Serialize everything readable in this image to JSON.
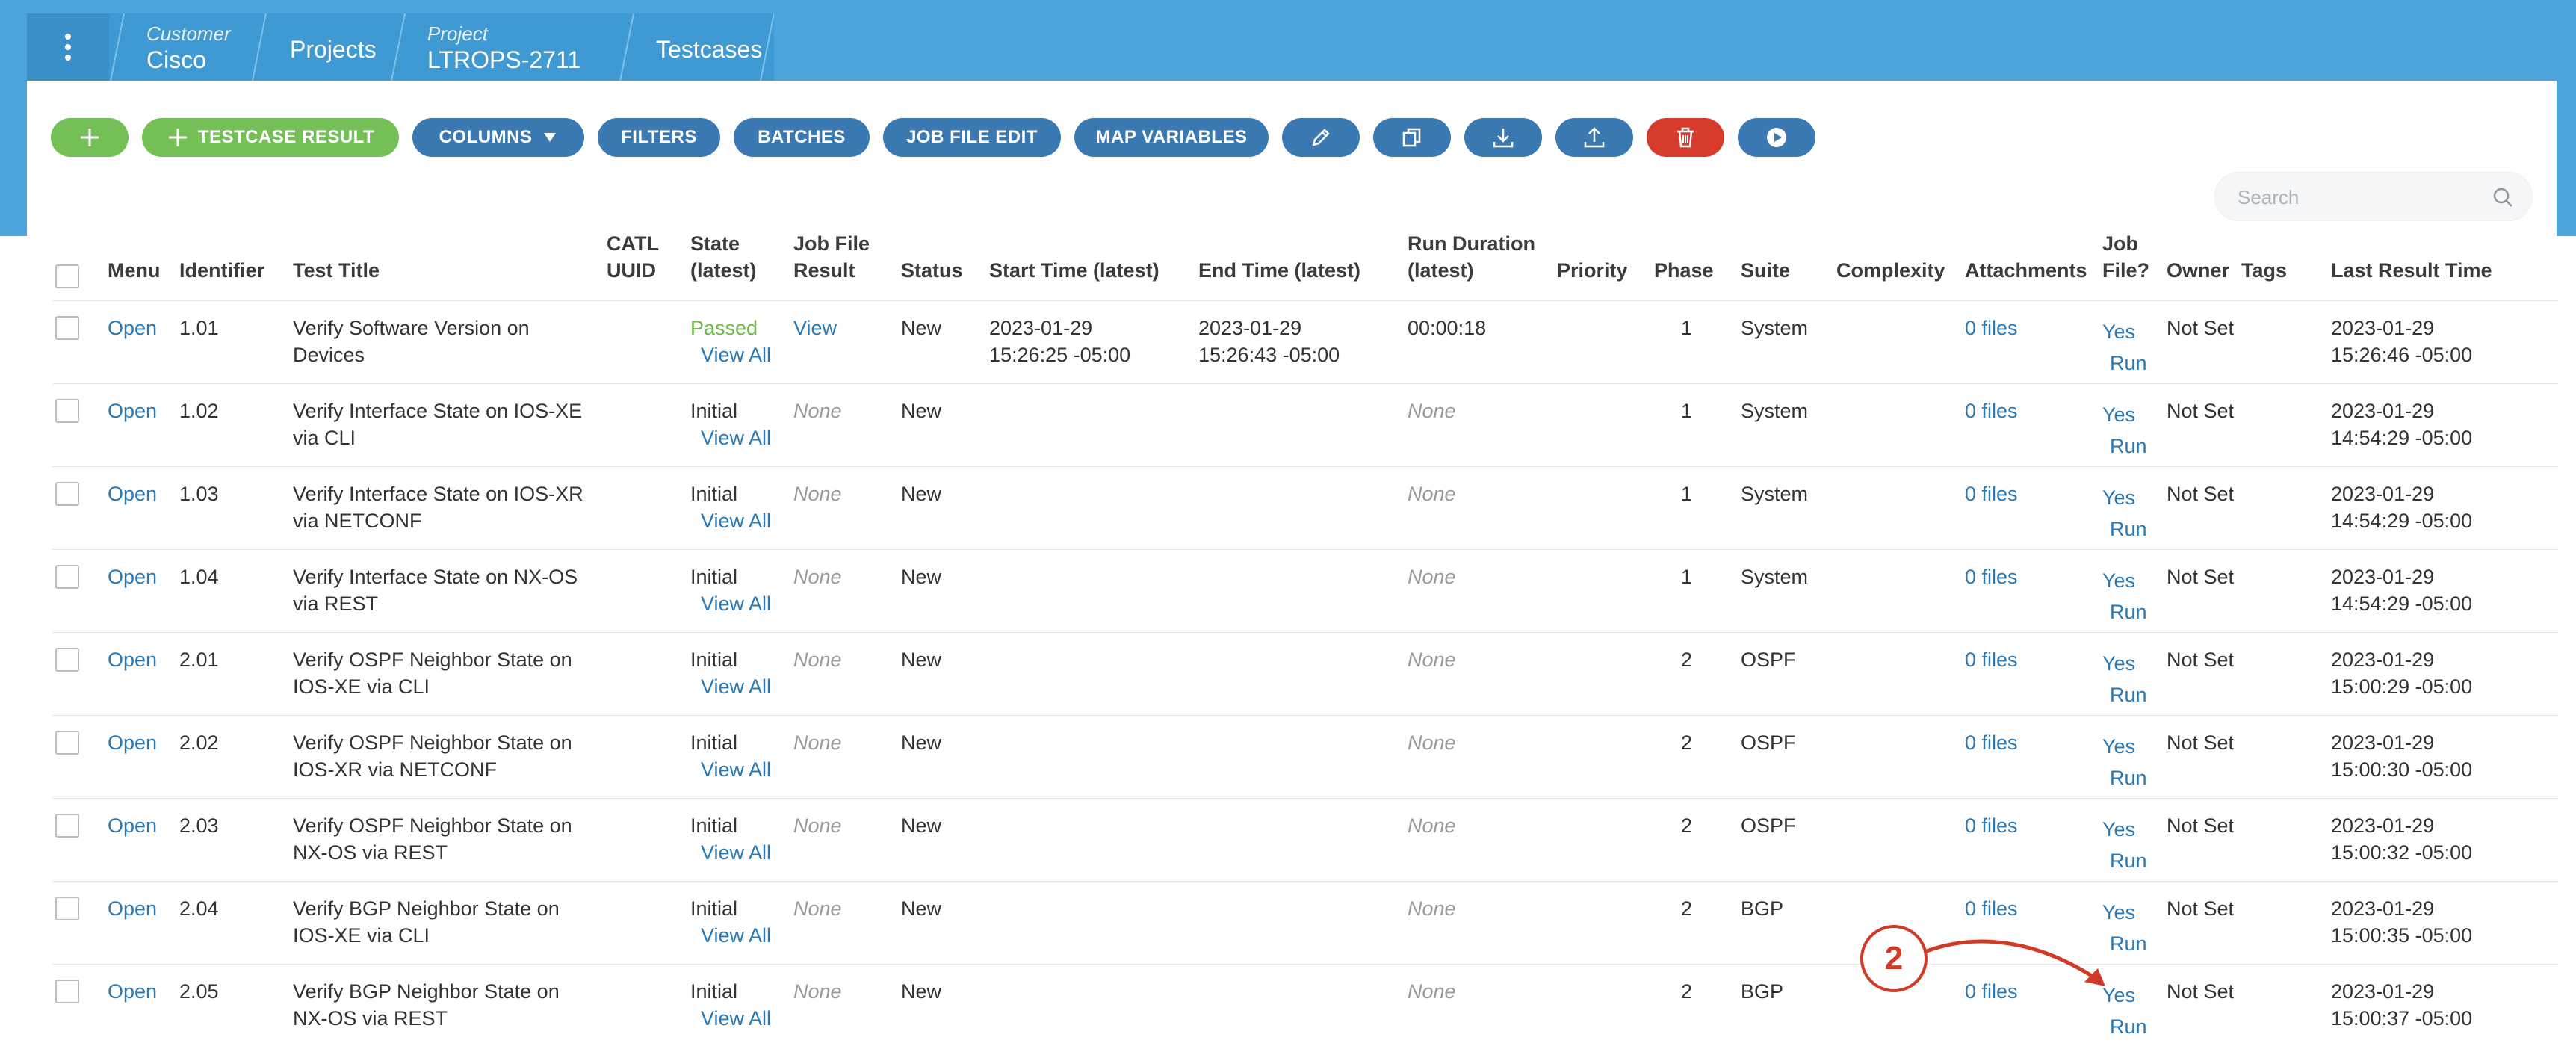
{
  "breadcrumb": {
    "customer_label": "Customer",
    "customer_value": "Cisco",
    "projects": "Projects",
    "project_label": "Project",
    "project_value": "LTROPS-2711",
    "testcases": "Testcases"
  },
  "toolbar": {
    "add_icon": "plus-icon",
    "testcase_result": "TESTCASE RESULT",
    "columns": "COLUMNS",
    "filters": "FILTERS",
    "batches": "BATCHES",
    "job_file_edit": "JOB FILE EDIT",
    "map_variables": "MAP VARIABLES",
    "icons": [
      "pencil-icon",
      "copy-icon",
      "download-icon",
      "upload-icon",
      "trash-icon",
      "play-icon"
    ],
    "colors": {
      "blue": "#3a79b2",
      "green": "#75bf57",
      "red": "#d73b2c"
    }
  },
  "search": {
    "placeholder": "Search"
  },
  "columns": {
    "menu": "Menu",
    "identifier": "Identifier",
    "test_title": "Test Title",
    "catl_uuid_1": "CATL",
    "catl_uuid_2": "UUID",
    "state_1": "State",
    "state_2": "(latest)",
    "job_file_result_1": "Job File",
    "job_file_result_2": "Result",
    "status": "Status",
    "start_time": "Start Time (latest)",
    "end_time": "End Time (latest)",
    "run_duration_1": "Run Duration",
    "run_duration_2": "(latest)",
    "priority": "Priority",
    "phase": "Phase",
    "suite": "Suite",
    "complexity": "Complexity",
    "attachments": "Attachments",
    "job_file_1": "Job",
    "job_file_2": "File?",
    "owner": "Owner",
    "tags": "Tags",
    "last_result_time": "Last Result Time"
  },
  "rows": [
    {
      "menu": "Open",
      "id": "1.01",
      "title1": "Verify Software Version on",
      "title2": "Devices",
      "state": "Passed",
      "state_link": "View All",
      "jfr": "View",
      "status": "New",
      "start1": "2023-01-29",
      "start2": "15:26:25 -05:00",
      "end1": "2023-01-29",
      "end2": "15:26:43 -05:00",
      "duration": "00:00:18",
      "phase": "1",
      "suite": "System",
      "attachments": "0 files",
      "jobfile": "Yes",
      "run": "Run",
      "owner": "Not Set",
      "last1": "2023-01-29",
      "last2": "15:26:46 -05:00"
    },
    {
      "menu": "Open",
      "id": "1.02",
      "title1": "Verify Interface State on IOS-XE",
      "title2": "via CLI",
      "state": "Initial",
      "state_link": "View All",
      "jfr": "None",
      "status": "New",
      "start1": "",
      "start2": "",
      "end1": "",
      "end2": "",
      "duration": "None",
      "phase": "1",
      "suite": "System",
      "attachments": "0 files",
      "jobfile": "Yes",
      "run": "Run",
      "owner": "Not Set",
      "last1": "2023-01-29",
      "last2": "14:54:29 -05:00"
    },
    {
      "menu": "Open",
      "id": "1.03",
      "title1": "Verify Interface State on IOS-XR",
      "title2": "via NETCONF",
      "state": "Initial",
      "state_link": "View All",
      "jfr": "None",
      "status": "New",
      "start1": "",
      "start2": "",
      "end1": "",
      "end2": "",
      "duration": "None",
      "phase": "1",
      "suite": "System",
      "attachments": "0 files",
      "jobfile": "Yes",
      "run": "Run",
      "owner": "Not Set",
      "last1": "2023-01-29",
      "last2": "14:54:29 -05:00"
    },
    {
      "menu": "Open",
      "id": "1.04",
      "title1": "Verify Interface State on NX-OS",
      "title2": "via REST",
      "state": "Initial",
      "state_link": "View All",
      "jfr": "None",
      "status": "New",
      "start1": "",
      "start2": "",
      "end1": "",
      "end2": "",
      "duration": "None",
      "phase": "1",
      "suite": "System",
      "attachments": "0 files",
      "jobfile": "Yes",
      "run": "Run",
      "owner": "Not Set",
      "last1": "2023-01-29",
      "last2": "14:54:29 -05:00"
    },
    {
      "menu": "Open",
      "id": "2.01",
      "title1": "Verify OSPF Neighbor State on",
      "title2": "IOS-XE via CLI",
      "state": "Initial",
      "state_link": "View All",
      "jfr": "None",
      "status": "New",
      "start1": "",
      "start2": "",
      "end1": "",
      "end2": "",
      "duration": "None",
      "phase": "2",
      "suite": "OSPF",
      "attachments": "0 files",
      "jobfile": "Yes",
      "run": "Run",
      "owner": "Not Set",
      "last1": "2023-01-29",
      "last2": "15:00:29 -05:00"
    },
    {
      "menu": "Open",
      "id": "2.02",
      "title1": "Verify OSPF Neighbor State on",
      "title2": "IOS-XR via NETCONF",
      "state": "Initial",
      "state_link": "View All",
      "jfr": "None",
      "status": "New",
      "start1": "",
      "start2": "",
      "end1": "",
      "end2": "",
      "duration": "None",
      "phase": "2",
      "suite": "OSPF",
      "attachments": "0 files",
      "jobfile": "Yes",
      "run": "Run",
      "owner": "Not Set",
      "last1": "2023-01-29",
      "last2": "15:00:30 -05:00"
    },
    {
      "menu": "Open",
      "id": "2.03",
      "title1": "Verify OSPF Neighbor State on",
      "title2": "NX-OS via REST",
      "state": "Initial",
      "state_link": "View All",
      "jfr": "None",
      "status": "New",
      "start1": "",
      "start2": "",
      "end1": "",
      "end2": "",
      "duration": "None",
      "phase": "2",
      "suite": "OSPF",
      "attachments": "0 files",
      "jobfile": "Yes",
      "run": "Run",
      "owner": "Not Set",
      "last1": "2023-01-29",
      "last2": "15:00:32 -05:00"
    },
    {
      "menu": "Open",
      "id": "2.04",
      "title1": "Verify BGP Neighbor State on",
      "title2": "IOS-XE via CLI",
      "state": "Initial",
      "state_link": "View All",
      "jfr": "None",
      "status": "New",
      "start1": "",
      "start2": "",
      "end1": "",
      "end2": "",
      "duration": "None",
      "phase": "2",
      "suite": "BGP",
      "attachments": "0 files",
      "jobfile": "Yes",
      "run": "Run",
      "owner": "Not Set",
      "last1": "2023-01-29",
      "last2": "15:00:35 -05:00"
    },
    {
      "menu": "Open",
      "id": "2.05",
      "title1": "Verify BGP Neighbor State on",
      "title2": "NX-OS via REST",
      "state": "Initial",
      "state_link": "View All",
      "jfr": "None",
      "status": "New",
      "start1": "",
      "start2": "",
      "end1": "",
      "end2": "",
      "duration": "None",
      "phase": "2",
      "suite": "BGP",
      "attachments": "0 files",
      "jobfile": "Yes",
      "run": "Run",
      "owner": "Not Set",
      "last1": "2023-01-29",
      "last2": "15:00:37 -05:00"
    }
  ],
  "annotation": {
    "label": "2",
    "color": "#cf3b26"
  }
}
